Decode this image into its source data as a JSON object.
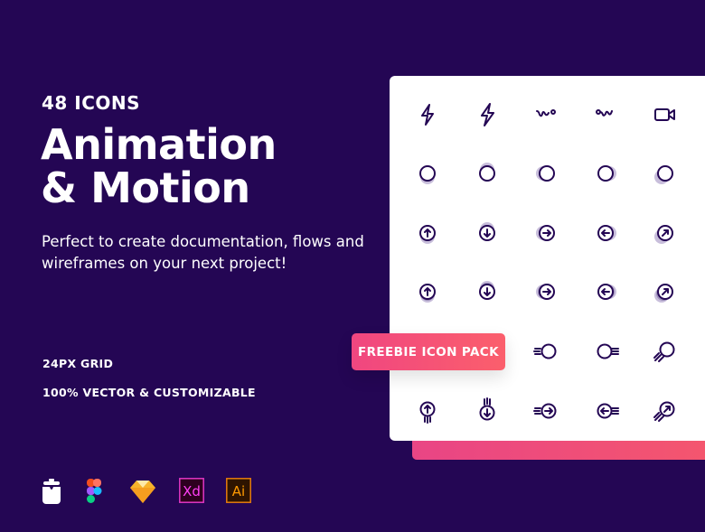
{
  "headline": {
    "count": "48 ICONS",
    "title_line1": "Animation",
    "title_line2": "& Motion",
    "description": "Perfect to create documentation, flows and wireframes on your next project!"
  },
  "features": [
    "24PX GRID",
    "100% VECTOR & CUSTOMIZABLE"
  ],
  "badge": "FREEBIE ICON PACK",
  "tools": [
    {
      "name": "craft-icon"
    },
    {
      "name": "figma-icon"
    },
    {
      "name": "sketch-icon"
    },
    {
      "name": "xd-icon",
      "label": "Xd"
    },
    {
      "name": "illustrator-icon",
      "label": "Ai"
    }
  ],
  "colors": {
    "background": "#240654",
    "icon_stroke": "#240654",
    "shadow": "#c8bedb",
    "accent_start": "#f04680",
    "accent_end": "#fb5f6c"
  },
  "icon_grid": [
    [
      "lightning-icon",
      "lightning-bold-icon",
      "wave-right-icon",
      "wave-left-icon",
      "video-icon"
    ],
    [
      "circle-up-motion-icon",
      "circle-down-motion-icon",
      "circle-right-motion-icon",
      "circle-left-motion-icon",
      "circle-diagonal-motion-icon"
    ],
    [
      "arrow-up-motion-icon",
      "arrow-down-motion-icon",
      "arrow-right-motion-icon",
      "arrow-left-motion-icon",
      "arrow-diagonal-motion-icon"
    ],
    [
      "arrow-up-blur-icon",
      "arrow-down-blur-icon",
      "arrow-right-blur-icon",
      "arrow-left-blur-icon",
      "arrow-diagonal-blur-icon"
    ],
    [
      "",
      "",
      "circle-speed-right-icon",
      "circle-speed-left-icon",
      "circle-speed-diagonal-icon"
    ],
    [
      "arrow-up-speed-icon",
      "arrow-down-speed-icon",
      "arrow-right-speed-icon",
      "arrow-left-speed-icon",
      "arrow-diagonal-speed-icon"
    ]
  ]
}
